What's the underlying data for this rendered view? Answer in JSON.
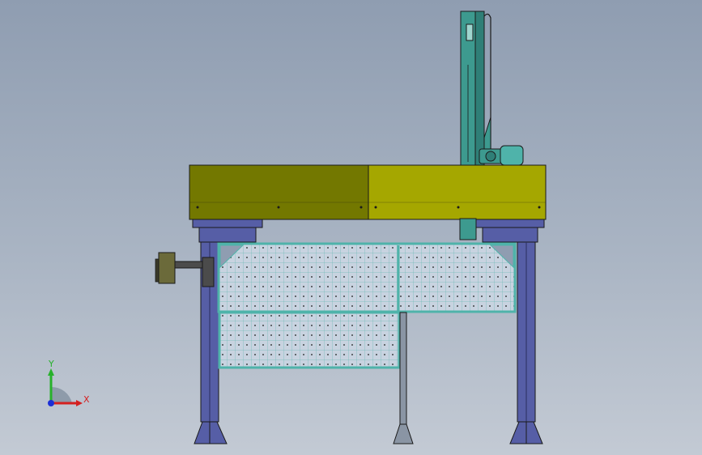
{
  "viewport": {
    "background_top": "#8f9db1",
    "background_bottom": "#c3cad4"
  },
  "model": {
    "colors": {
      "beam_left": "#737800",
      "beam_right": "#a5a700",
      "frame_blue": "#565ea6",
      "frame_dark": "#2a2f5e",
      "guard_teal": "#4fb3aa",
      "guard_panel": "#c8d3e0",
      "mast_teal": "#3d9a8f",
      "pendant_olive": "#6b6a3a",
      "outline": "#1a1a1a"
    },
    "parts": [
      "gantry-beam",
      "left-leg",
      "right-leg",
      "vertical-mast",
      "drive-motor",
      "safety-guard-upper",
      "safety-guard-lower",
      "center-post",
      "control-pendant"
    ]
  },
  "triad": {
    "x_label": "X",
    "y_label": "Y",
    "x_color": "#d42020",
    "y_color": "#27b12b",
    "z_color": "#1c2fd6",
    "origin_color": "#7a8a9a"
  }
}
